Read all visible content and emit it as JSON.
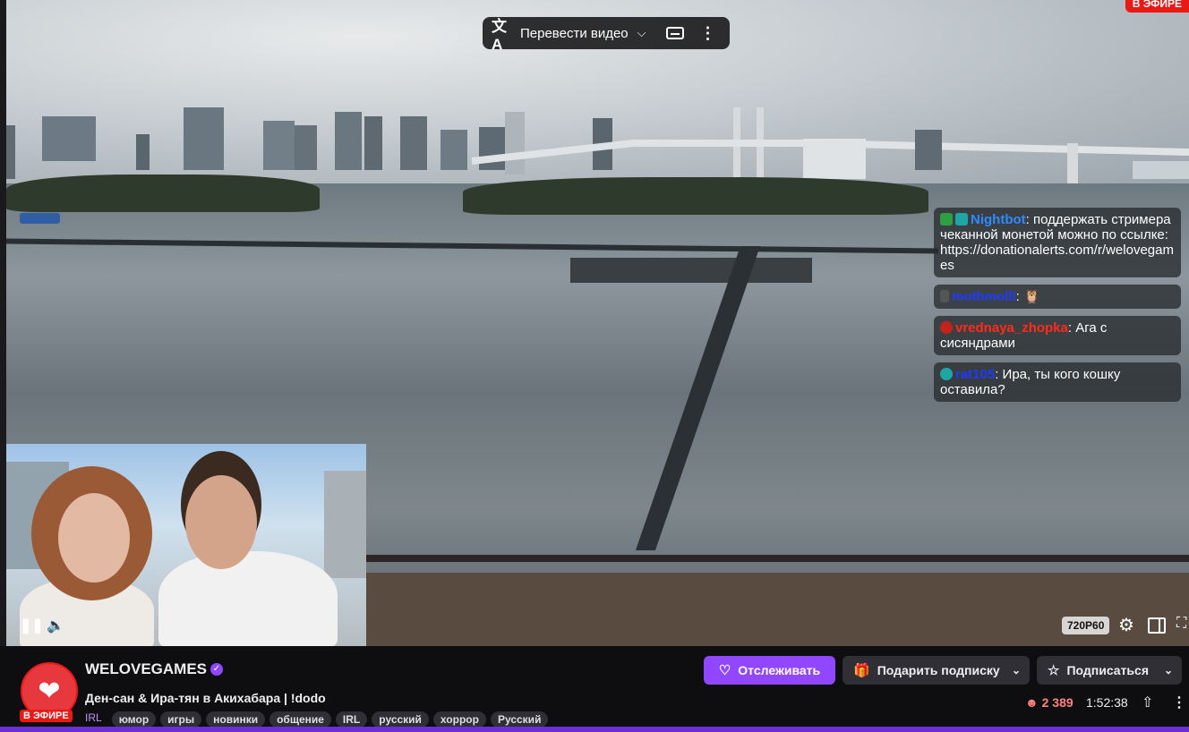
{
  "player": {
    "live_badge": "В ЭФИРЕ",
    "translate_label": "Перевести видео",
    "quality": "720P60"
  },
  "chat": [
    {
      "user": "Nightbot",
      "user_color": "#2e8bff",
      "text": ": поддержать стримера чеканной монетой можно по ссылке: https://donationalerts.com/r/welovegames"
    },
    {
      "user": "mothmolli",
      "user_color": "#1e3bff",
      "text": ": 🦉"
    },
    {
      "user": "vrednaya_zhopka",
      "user_color": "#ff2a1a",
      "text": ": Ага с сисяндрами"
    },
    {
      "user": "rat105",
      "user_color": "#1e3bff",
      "text": ": Ира, ты кого кошку оставила?"
    }
  ],
  "channel": {
    "name": "WELOVEGAMES",
    "live_badge": "В ЭФИРЕ",
    "title": "Ден-сан & Ира-тян в Акихабара | !dodo",
    "category": "IRL",
    "tags": [
      "юмор",
      "игры",
      "новинки",
      "общение",
      "IRL",
      "русский",
      "хоррор",
      "Русский"
    ]
  },
  "actions": {
    "follow": "Отслеживать",
    "gift": "Подарить подписку",
    "subscribe": "Подписаться"
  },
  "stats": {
    "viewers": "2 389",
    "uptime": "1:52:38"
  },
  "icons": [
    "translate-icon",
    "chevron-down-icon",
    "captions-icon",
    "more-vertical-icon",
    "pause-icon",
    "volume-icon",
    "settings-icon",
    "theatre-mode-icon",
    "fullscreen-icon",
    "heart-icon",
    "gift-icon",
    "star-icon",
    "viewers-icon",
    "share-icon",
    "verified-icon"
  ]
}
